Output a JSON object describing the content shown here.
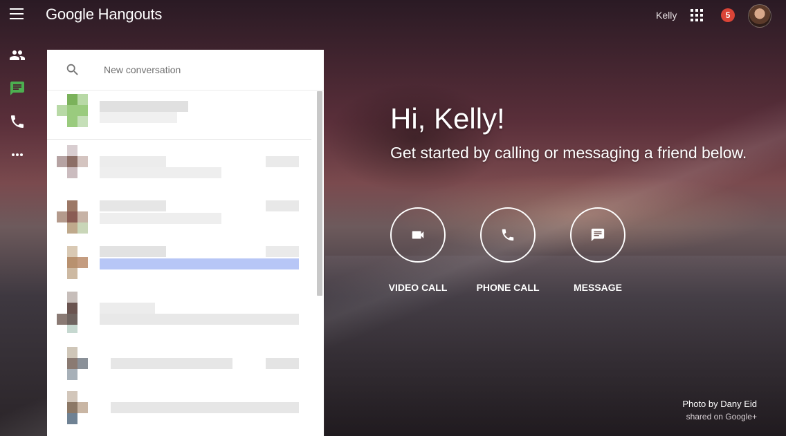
{
  "app": {
    "logo_text": "Google Hangouts",
    "user_name": "Kelly",
    "notification_count": "5"
  },
  "nav": {
    "items": [
      {
        "icon": "contacts-icon",
        "active": false
      },
      {
        "icon": "conversations-icon",
        "active": true
      },
      {
        "icon": "phone-icon",
        "active": false
      },
      {
        "icon": "more-icon",
        "active": false
      }
    ]
  },
  "search": {
    "placeholder": "New conversation"
  },
  "conversations": [
    {
      "avatar_colors": [
        "#9acb7e",
        "#7bb25b",
        "#b8d9a6"
      ],
      "highlight": false
    },
    {
      "avatar_colors": [
        "#cbbcbf",
        "#8c6e66",
        "#d8cdd0"
      ],
      "highlight": false
    },
    {
      "avatar_colors": [
        "#b49a8c",
        "#8a5c54",
        "#c9d6b8"
      ],
      "highlight": false
    },
    {
      "avatar_colors": [
        "#d9c9b4",
        "#b8916f",
        "#cdb9a2"
      ],
      "highlight": true
    },
    {
      "avatar_colors": [
        "#c7beba",
        "#6a5450",
        "#c6d8d0"
      ],
      "highlight": false
    },
    {
      "avatar_colors": [
        "#cfc6b8",
        "#8a7a72",
        "#a7b0b8"
      ],
      "highlight": false
    },
    {
      "avatar_colors": [
        "#d2c6ba",
        "#8c7866",
        "#6f8294"
      ],
      "highlight": false
    }
  ],
  "welcome": {
    "greeting": "Hi, Kelly!",
    "subtitle": "Get started by calling or messaging a friend below."
  },
  "actions": [
    {
      "icon": "video-camera-icon",
      "label": "VIDEO CALL"
    },
    {
      "icon": "phone-icon",
      "label": "PHONE CALL"
    },
    {
      "icon": "message-icon",
      "label": "MESSAGE"
    }
  ],
  "credit": {
    "photo_by": "Photo by Dany Eid",
    "shared_on": "shared on Google+"
  },
  "colors": {
    "accent_green": "#4caf50",
    "notification_red": "#db4437",
    "highlight_blue": "#a8bbf5"
  }
}
